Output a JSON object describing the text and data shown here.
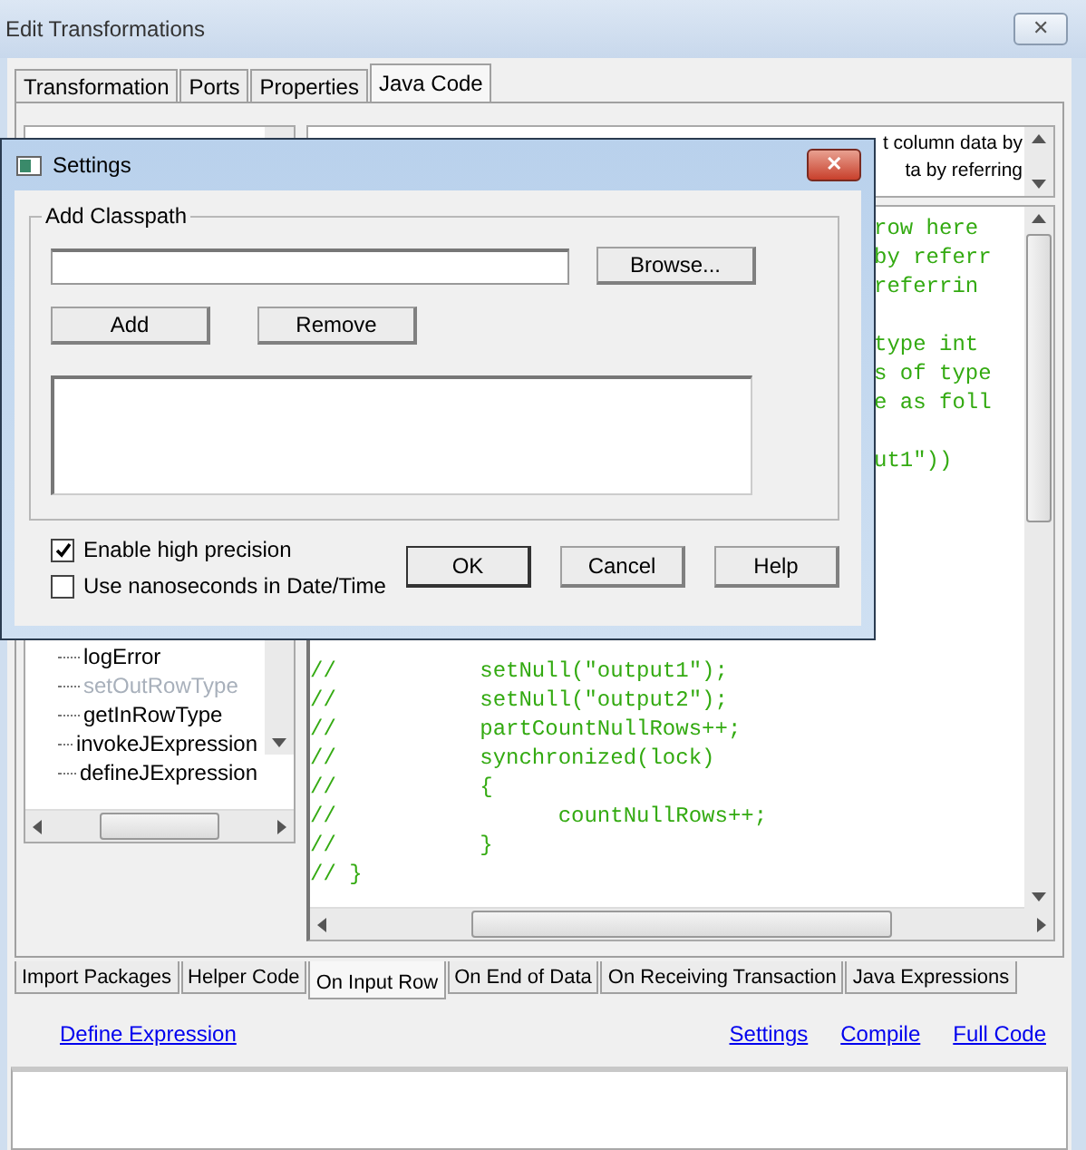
{
  "window": {
    "title": "Edit Transformations",
    "close": "✕"
  },
  "tabs": [
    {
      "label": "Transformation",
      "selected": false
    },
    {
      "label": "Ports",
      "selected": false
    },
    {
      "label": "Properties",
      "selected": false
    },
    {
      "label": "Java Code",
      "selected": true
    }
  ],
  "function_tree": {
    "items": [
      {
        "label": "logError",
        "disabled": false
      },
      {
        "label": "setOutRowType",
        "disabled": true
      },
      {
        "label": "getInRowType",
        "disabled": false
      },
      {
        "label": "invokeJExpression",
        "disabled": false
      },
      {
        "label": "defineJExpression",
        "disabled": false
      }
    ]
  },
  "description": {
    "lines": [
      "t column data by",
      "ta by referring"
    ]
  },
  "code": {
    "top_fragment_blocks": [
      [
        "row here",
        "by referr",
        "referrin"
      ],
      [
        "type int",
        "s of type",
        "e as foll"
      ],
      [
        "ut1\"))"
      ]
    ],
    "lines": [
      "//           setNull(\"output1\");",
      "//           setNull(\"output2\");",
      "//           partCountNullRows++;",
      "//           synchronized(lock)",
      "//           {",
      "//                 countNullRows++;",
      "//           }",
      "// }"
    ]
  },
  "bottom_tabs": [
    {
      "label": "Import Packages",
      "selected": false
    },
    {
      "label": "Helper Code",
      "selected": false
    },
    {
      "label": "On Input Row",
      "selected": true
    },
    {
      "label": "On End of Data",
      "selected": false
    },
    {
      "label": "On Receiving Transaction",
      "selected": false
    },
    {
      "label": "Java Expressions",
      "selected": false
    }
  ],
  "links": {
    "left": "Define Expression",
    "right": [
      "Settings",
      "Compile",
      "Full Code"
    ]
  },
  "settings_dialog": {
    "title": "Settings",
    "close": "✕",
    "group_title": "Add Classpath",
    "browse": "Browse...",
    "add": "Add",
    "remove": "Remove",
    "checkboxes": [
      {
        "label": "Enable high precision",
        "checked": true
      },
      {
        "label": "Use nanoseconds in Date/Time",
        "checked": false
      }
    ],
    "buttons": [
      "OK",
      "Cancel",
      "Help"
    ]
  }
}
